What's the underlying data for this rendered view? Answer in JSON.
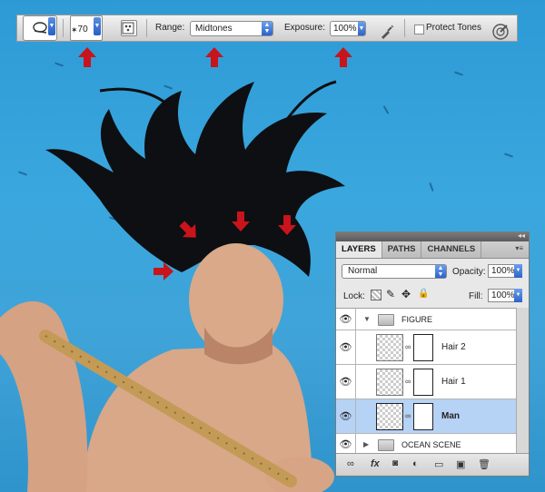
{
  "options_bar": {
    "brush_size": "70",
    "range_label": "Range:",
    "range_value": "Midtones",
    "exposure_label": "Exposure:",
    "exposure_value": "100%",
    "protect_tones_label": "Protect Tones",
    "protect_tones_checked": false
  },
  "layers_panel": {
    "tabs": [
      "LAYERS",
      "PATHS",
      "CHANNELS"
    ],
    "blend_mode": "Normal",
    "opacity_label": "Opacity:",
    "opacity_value": "100%",
    "lock_label": "Lock:",
    "fill_label": "Fill:",
    "fill_value": "100%",
    "layers": [
      {
        "name": "FIGURE",
        "type": "group",
        "expanded": true
      },
      {
        "name": "Hair 2",
        "type": "layer"
      },
      {
        "name": "Hair 1",
        "type": "layer"
      },
      {
        "name": "Man",
        "type": "layer",
        "selected": true
      },
      {
        "name": "OCEAN SCENE",
        "type": "group",
        "expanded": false
      }
    ]
  },
  "colors": {
    "accent_red": "#c8141a",
    "selection": "#b6d2f5",
    "water": "#2d9ad6"
  }
}
